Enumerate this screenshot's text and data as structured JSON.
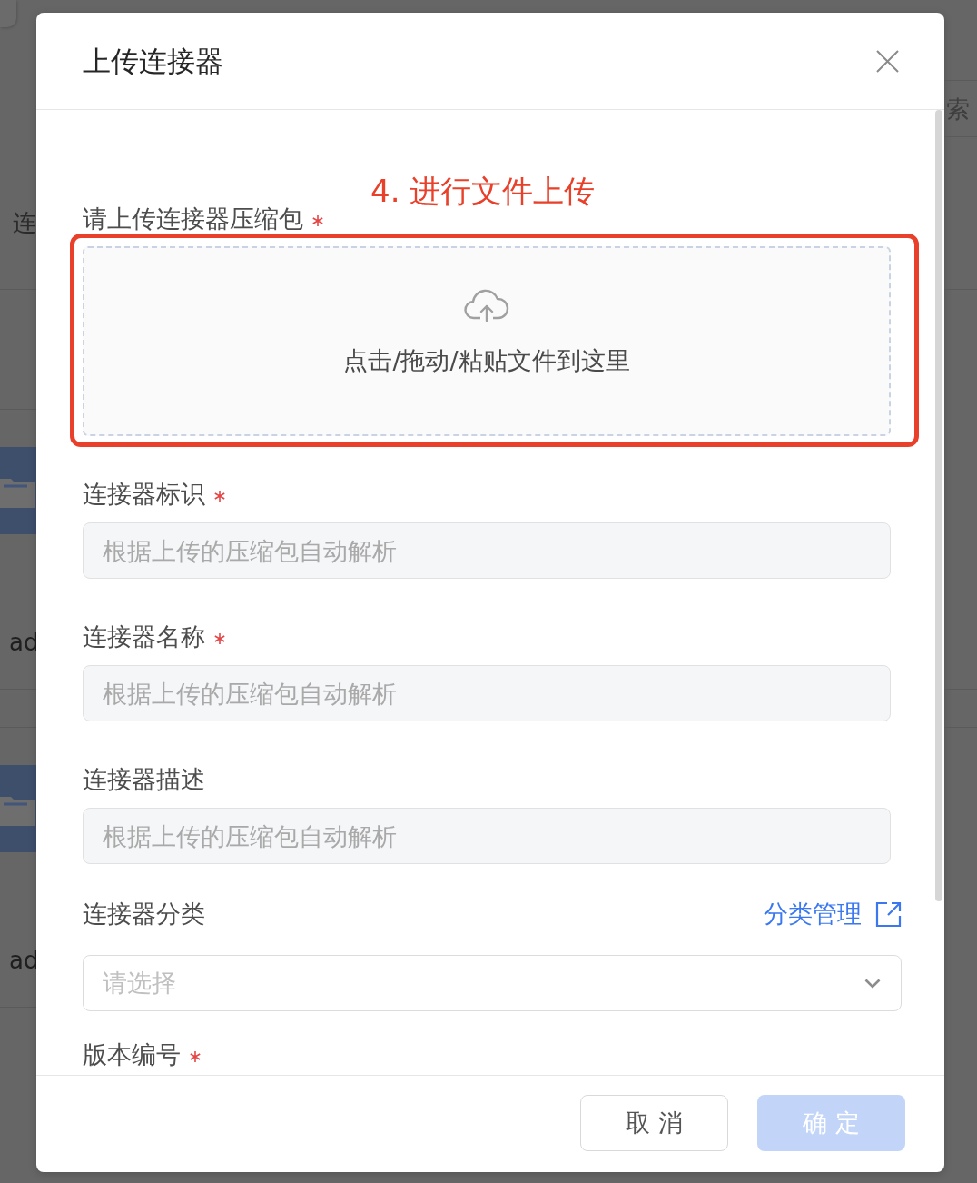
{
  "background": {
    "heading": "连",
    "search_field": {
      "placeholder": "索"
    },
    "rows": [
      {
        "cell": "ad"
      },
      {
        "cell": "ad"
      }
    ]
  },
  "dialog": {
    "title": "上传连接器",
    "upload": {
      "label": "请上传连接器压缩包",
      "required": true,
      "hint": "点击/拖动/粘贴文件到这里"
    },
    "fields": [
      {
        "kind": "text",
        "label": "连接器标识",
        "required": true,
        "placeholder": "根据上传的压缩包自动解析",
        "disabled": true
      },
      {
        "kind": "text",
        "label": "连接器名称",
        "required": true,
        "placeholder": "根据上传的压缩包自动解析",
        "disabled": true
      },
      {
        "kind": "text",
        "label": "连接器描述",
        "required": false,
        "placeholder": "根据上传的压缩包自动解析",
        "disabled": true
      },
      {
        "kind": "select",
        "label": "连接器分类",
        "required": false,
        "placeholder": "请选择",
        "disabled": false,
        "link": "分类管理"
      },
      {
        "kind": "text",
        "label": "版本编号",
        "required": true
      }
    ],
    "buttons": [
      {
        "label": "取 消",
        "kind": "secondary",
        "disabled": false
      },
      {
        "label": "确 定",
        "kind": "primary",
        "disabled": true
      }
    ]
  },
  "annotation": {
    "text": "4. 进行文件上传"
  }
}
